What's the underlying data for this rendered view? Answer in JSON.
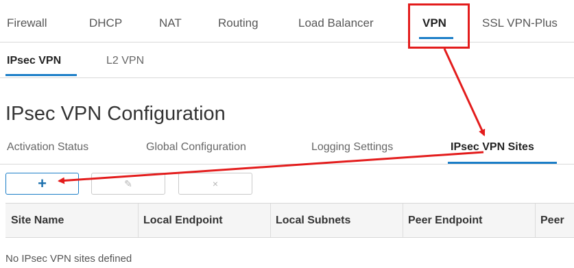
{
  "top_tabs": [
    {
      "label": "Firewall",
      "active": false
    },
    {
      "label": "DHCP",
      "active": false
    },
    {
      "label": "NAT",
      "active": false
    },
    {
      "label": "Routing",
      "active": false
    },
    {
      "label": "Load Balancer",
      "active": false
    },
    {
      "label": "VPN",
      "active": true
    },
    {
      "label": "SSL VPN-Plus",
      "active": false
    }
  ],
  "vpn_tabs": [
    {
      "label": "IPsec VPN",
      "active": true
    },
    {
      "label": "L2 VPN",
      "active": false
    }
  ],
  "page_title": "IPsec VPN Configuration",
  "config_tabs": [
    {
      "label": "Activation Status",
      "active": false
    },
    {
      "label": "Global Configuration",
      "active": false
    },
    {
      "label": "Logging Settings",
      "active": false
    },
    {
      "label": "IPsec VPN Sites",
      "active": true
    }
  ],
  "toolbar": {
    "add_icon": "plus-icon",
    "edit_icon": "edit-icon",
    "delete_icon": "delete-icon",
    "add_glyph": "+",
    "edit_glyph": "✎",
    "delete_glyph": "×"
  },
  "table": {
    "columns": [
      "Site Name",
      "Local Endpoint",
      "Local Subnets",
      "Peer Endpoint",
      "Peer"
    ],
    "empty_message": "No IPsec VPN sites defined"
  },
  "annotations": {
    "callout_color": "#e31c1c",
    "accent_color": "#1a7dc7"
  }
}
